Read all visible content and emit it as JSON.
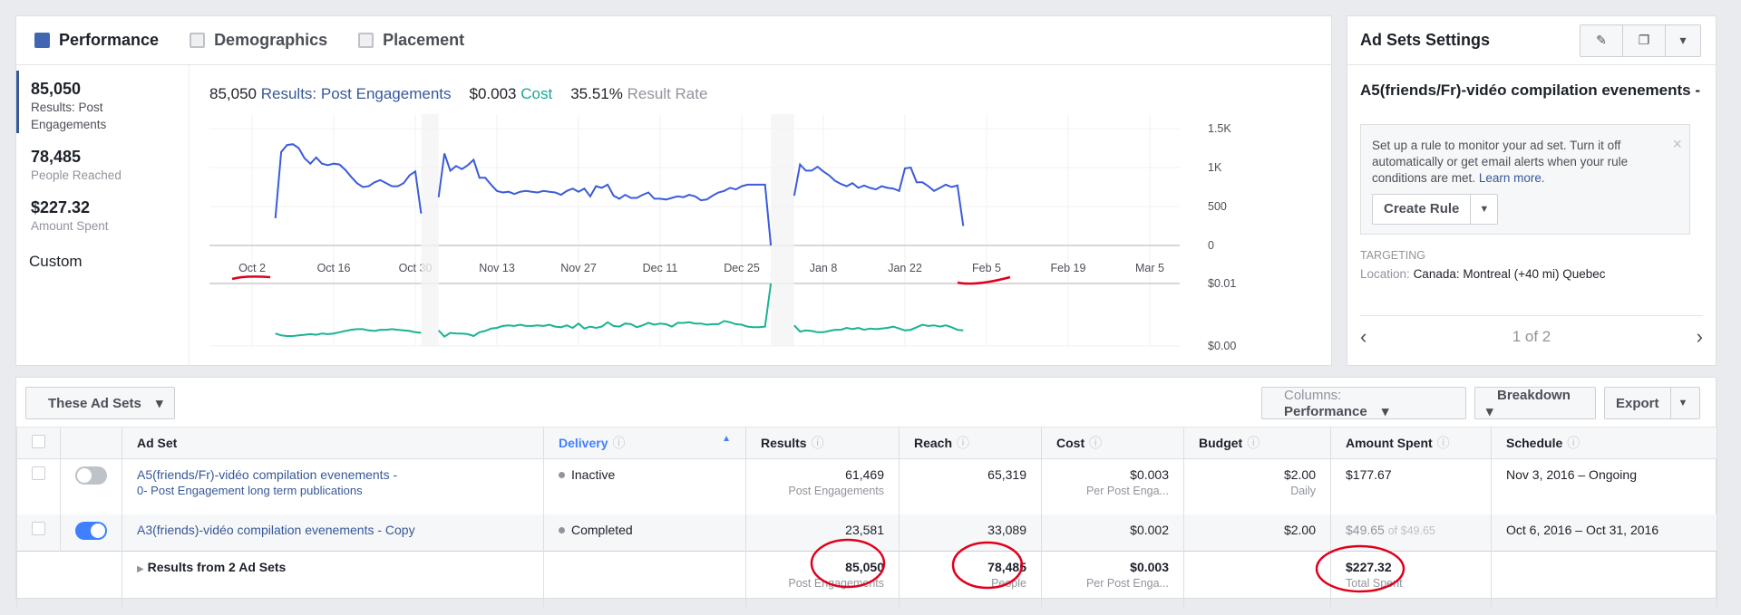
{
  "tabs": [
    {
      "label": "Performance",
      "icon": "bar-chart-icon",
      "active": true
    },
    {
      "label": "Demographics",
      "icon": "people-icon"
    },
    {
      "label": "Placement",
      "icon": "placement-icon"
    }
  ],
  "stats": [
    {
      "value": "85,050",
      "label": "Results: Post Engagements"
    },
    {
      "value": "78,485",
      "label": "People Reached"
    },
    {
      "value": "$227.32",
      "label": "Amount Spent"
    }
  ],
  "custom_label": "Custom",
  "summary": {
    "results_value": "85,050",
    "results_label": "Results: Post Engagements",
    "cost_value": "$0.003",
    "cost_label": "Cost",
    "rate_value": "35.51%",
    "rate_label": "Result Rate"
  },
  "colors": {
    "results": "#3b5bdb",
    "cost": "#19b394",
    "annotation": "#e0001b",
    "accent": "#4267b2"
  },
  "chart_data": {
    "type": "line",
    "x_ticks": [
      "Oct 2",
      "Oct 16",
      "Oct 30",
      "Nov 13",
      "Nov 27",
      "Dec 11",
      "Dec 25",
      "Jan 8",
      "Jan 22",
      "Feb 5",
      "Feb 19",
      "Mar 5"
    ],
    "x_range": [
      "2016-10-02",
      "2017-03-05"
    ],
    "results_axis": {
      "ticks": [
        "1.5K",
        "1K",
        "500",
        "0"
      ],
      "ylim": [
        0,
        1500
      ]
    },
    "cost_axis": {
      "ticks": [
        "$0.01",
        "$0.00"
      ],
      "ylim": [
        0,
        0.01
      ]
    },
    "grid": true,
    "segments": [
      {
        "start": "2016-10-06",
        "results": [
          350,
          1200,
          1290,
          1300,
          1250,
          1120,
          1050,
          1130,
          1050,
          1030,
          1050,
          1040,
          970,
          880,
          800,
          750,
          760,
          810,
          840,
          800,
          760,
          760,
          800,
          900,
          950,
          410
        ],
        "cost": [
          0.002,
          0.0017,
          0.0016,
          0.0016,
          0.0017,
          0.0018,
          0.0019,
          0.0018,
          0.002,
          0.0019,
          0.002,
          0.0022,
          0.0024,
          0.0026,
          0.0027,
          0.0027,
          0.0025,
          0.0024,
          0.0026,
          0.0026,
          0.0027,
          0.0026,
          0.0025,
          0.0024,
          0.0022,
          0.0021
        ]
      },
      {
        "start": "2016-11-03",
        "results": [
          620,
          1180,
          960,
          1020,
          980,
          1030,
          1100,
          870,
          870,
          780,
          700,
          680,
          690,
          660,
          690,
          700,
          690,
          680,
          700,
          690,
          680,
          650,
          700,
          730,
          690,
          730,
          630,
          760,
          740,
          780,
          640,
          600,
          650,
          610,
          610,
          650,
          680,
          600,
          600,
          590,
          610,
          630,
          620,
          650,
          630,
          580,
          590,
          640,
          680,
          700,
          740,
          720,
          760,
          780,
          780,
          780,
          780,
          0
        ],
        "cost": [
          0.0025,
          0.0015,
          0.0021,
          0.002,
          0.002,
          0.0019,
          0.0016,
          0.0022,
          0.0024,
          0.0028,
          0.0029,
          0.0032,
          0.0033,
          0.0032,
          0.0034,
          0.0032,
          0.0032,
          0.0033,
          0.0032,
          0.0034,
          0.0031,
          0.003,
          0.0033,
          0.0029,
          0.0036,
          0.0028,
          0.0031,
          0.0029,
          0.0031,
          0.0038,
          0.0032,
          0.0031,
          0.0036,
          0.0035,
          0.003,
          0.0033,
          0.0037,
          0.0034,
          0.0036,
          0.0035,
          0.0031,
          0.0037,
          0.0037,
          0.0038,
          0.0036,
          0.0036,
          0.0034,
          0.0035,
          0.0035,
          0.004,
          0.0038,
          0.0035,
          0.0034,
          0.0031,
          0.003,
          0.003,
          0.0031,
          0.011
        ]
      },
      {
        "start": "2017-01-03",
        "results": [
          640,
          1040,
          960,
          960,
          1010,
          950,
          900,
          830,
          790,
          760,
          800,
          740,
          770,
          740,
          720,
          760,
          740,
          730,
          700,
          990,
          1000,
          810,
          810,
          760,
          700,
          740,
          780,
          750,
          770,
          250
        ],
        "cost": [
          0.0033,
          0.0023,
          0.0025,
          0.0024,
          0.0022,
          0.0022,
          0.0024,
          0.0026,
          0.0026,
          0.0029,
          0.0027,
          0.0029,
          0.0026,
          0.0028,
          0.0027,
          0.0028,
          0.0029,
          0.0031,
          0.0028,
          0.0025,
          0.0026,
          0.003,
          0.0034,
          0.0032,
          0.0033,
          0.0031,
          0.0033,
          0.003,
          0.0026,
          0.0025
        ]
      }
    ]
  },
  "settings": {
    "title": "Ad Sets Settings",
    "edit_icon": "pencil-icon",
    "duplicate_icon": "duplicate-icon",
    "ad_name": "A5(friends/Fr)-vidéo compilation evenements -",
    "rule_text": "Set up a rule to monitor your ad set. Turn it off automatically or get email alerts when your rule conditions are met.",
    "rule_link": "Learn more.",
    "create_rule": "Create Rule",
    "targeting_label": "TARGETING",
    "location_label": "Location:",
    "location_value": "Canada: Montreal (+40 mi) Quebec",
    "pager": "1 of 2"
  },
  "toolbar": {
    "filter": "These Ad Sets",
    "columns_label": "Columns:",
    "columns_value": "Performance",
    "breakdown": "Breakdown",
    "export": "Export"
  },
  "table": {
    "headers": [
      "Ad Set",
      "Delivery",
      "Results",
      "Reach",
      "Cost",
      "Budget",
      "Amount Spent",
      "Schedule"
    ],
    "rows": [
      {
        "on": false,
        "name": "A5(friends/Fr)-vidéo compilation evenements -",
        "campaign": "0- Post Engagement long term publications",
        "delivery": "Inactive",
        "results": "61,469",
        "results_sub": "Post Engagements",
        "reach": "65,319",
        "cost": "$0.003",
        "cost_sub": "Per Post Enga...",
        "budget": "$2.00",
        "budget_sub": "Daily",
        "spent": "$177.67",
        "spent_of": "",
        "schedule": "Nov 3, 2016 – Ongoing"
      },
      {
        "on": true,
        "name": "A3(friends)-vidéo compilation evenements - Copy",
        "campaign": "",
        "delivery": "Completed",
        "results": "23,581",
        "results_sub": "",
        "reach": "33,089",
        "cost": "$0.002",
        "cost_sub": "",
        "budget": "$2.00",
        "budget_sub": "",
        "spent": "$49.65",
        "spent_of": "of $49.65",
        "schedule": "Oct 6, 2016 – Oct 31, 2016"
      }
    ],
    "totals": {
      "label": "Results from 2 Ad Sets",
      "results": "85,050",
      "results_sub": "Post Engagements",
      "reach": "78,485",
      "reach_sub": "People",
      "cost": "$0.003",
      "cost_sub": "Per Post Enga...",
      "spent": "$227.32",
      "spent_sub": "Total Spent"
    }
  }
}
